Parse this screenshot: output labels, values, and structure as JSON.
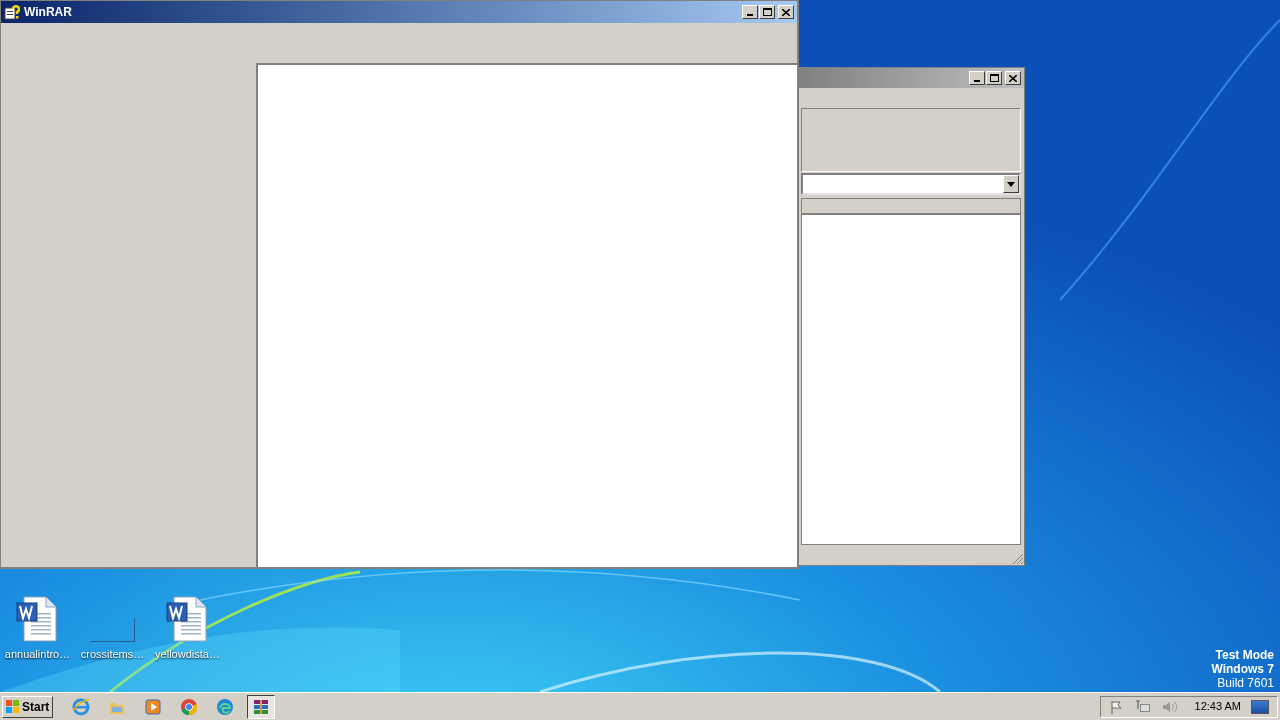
{
  "main_window": {
    "title": "WinRAR"
  },
  "desktop_icons": [
    {
      "label": "annualintro…",
      "kind": "document"
    },
    {
      "label": "crossitems…",
      "kind": "blank"
    },
    {
      "label": "yellowdista…",
      "kind": "document"
    }
  ],
  "os_notice": [
    "Test Mode",
    "Windows 7",
    "Build 7601"
  ],
  "taskbar": {
    "start": "Start",
    "apps": [
      {
        "kind": "ie",
        "selected": false
      },
      {
        "kind": "folder",
        "selected": false
      },
      {
        "kind": "media",
        "selected": false
      },
      {
        "kind": "chrome",
        "selected": false
      },
      {
        "kind": "edge",
        "selected": false
      },
      {
        "kind": "archive",
        "selected": true
      }
    ],
    "clock": "12:43 AM"
  }
}
